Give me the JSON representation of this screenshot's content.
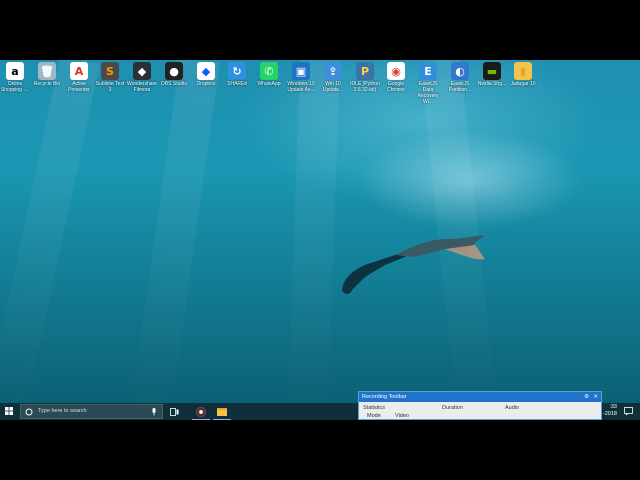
{
  "desktop": {
    "icons": [
      {
        "label": "Online Shopping -...",
        "icon": "amazon-icon",
        "glyph": "a",
        "color": "#ffffff",
        "fg": "#000000"
      },
      {
        "label": "Recycle Bin",
        "icon": "recycle-bin-icon",
        "glyph": "🗑",
        "color": "#9fb8c8",
        "fg": "#ffffff"
      },
      {
        "label": "Active Presenter",
        "icon": "active-presenter-icon",
        "glyph": "A",
        "color": "#ffffff",
        "fg": "#d93030"
      },
      {
        "label": "Sublime Text 3",
        "icon": "sublime-text-icon",
        "glyph": "S",
        "color": "#4a4a4a",
        "fg": "#ff9800"
      },
      {
        "label": "Wondershare Filmora",
        "icon": "filmora-icon",
        "glyph": "◆",
        "color": "#2b3038",
        "fg": "#ffffff"
      },
      {
        "label": "OBS Studio",
        "icon": "obs-icon",
        "glyph": "●",
        "color": "#222222",
        "fg": "#ffffff"
      },
      {
        "label": "Dropbox",
        "icon": "dropbox-icon",
        "glyph": "◆",
        "color": "#ffffff",
        "fg": "#0061fe"
      },
      {
        "label": "SHAREit",
        "icon": "shareit-icon",
        "glyph": "↻",
        "color": "#2f8fe0",
        "fg": "#ffffff"
      },
      {
        "label": "WhatsApp",
        "icon": "whatsapp-icon",
        "glyph": "✆",
        "color": "#25d366",
        "fg": "#ffffff"
      },
      {
        "label": "Windows 10 Update As...",
        "icon": "windows-update-icon",
        "glyph": "▣",
        "color": "#1e73c8",
        "fg": "#ffffff"
      },
      {
        "label": "Win 10 Update...",
        "icon": "update-assistant-icon",
        "glyph": "⇪",
        "color": "#3d8fd8",
        "fg": "#ffffff"
      },
      {
        "label": "IDLE (Python 3.6 32-bit)",
        "icon": "python-idle-icon",
        "glyph": "P",
        "color": "#3b73a8",
        "fg": "#ffd43b"
      },
      {
        "label": "Google Chrome",
        "icon": "chrome-icon",
        "glyph": "◉",
        "color": "#ffffff",
        "fg": "#db4437"
      },
      {
        "label": "EaseUS Data Recovery Wi...",
        "icon": "easeus-icon",
        "glyph": "E",
        "color": "#2f8fdc",
        "fg": "#ffffff"
      },
      {
        "label": "EaseUS Partition...",
        "icon": "easeus-partition-icon",
        "glyph": "◐",
        "color": "#3078d0",
        "fg": "#ffffff"
      },
      {
        "label": "Nvidia Shg...",
        "icon": "nvidia-icon",
        "glyph": "▬",
        "color": "#1a1a1a",
        "fg": "#76b900"
      },
      {
        "label": "Jadugar 10",
        "icon": "folder-icon",
        "glyph": "▮",
        "color": "#f3c34a",
        "fg": "#e3a82a"
      }
    ]
  },
  "taskbar": {
    "search_placeholder": "Type here to search",
    "clock_time": ":33",
    "clock_date": "-2018"
  },
  "recording_toolbar": {
    "title": "Recording Toolbar",
    "columns": [
      "Statistics",
      "Duration",
      "Audio"
    ],
    "row_labels": [
      "Mode",
      "Video"
    ]
  }
}
